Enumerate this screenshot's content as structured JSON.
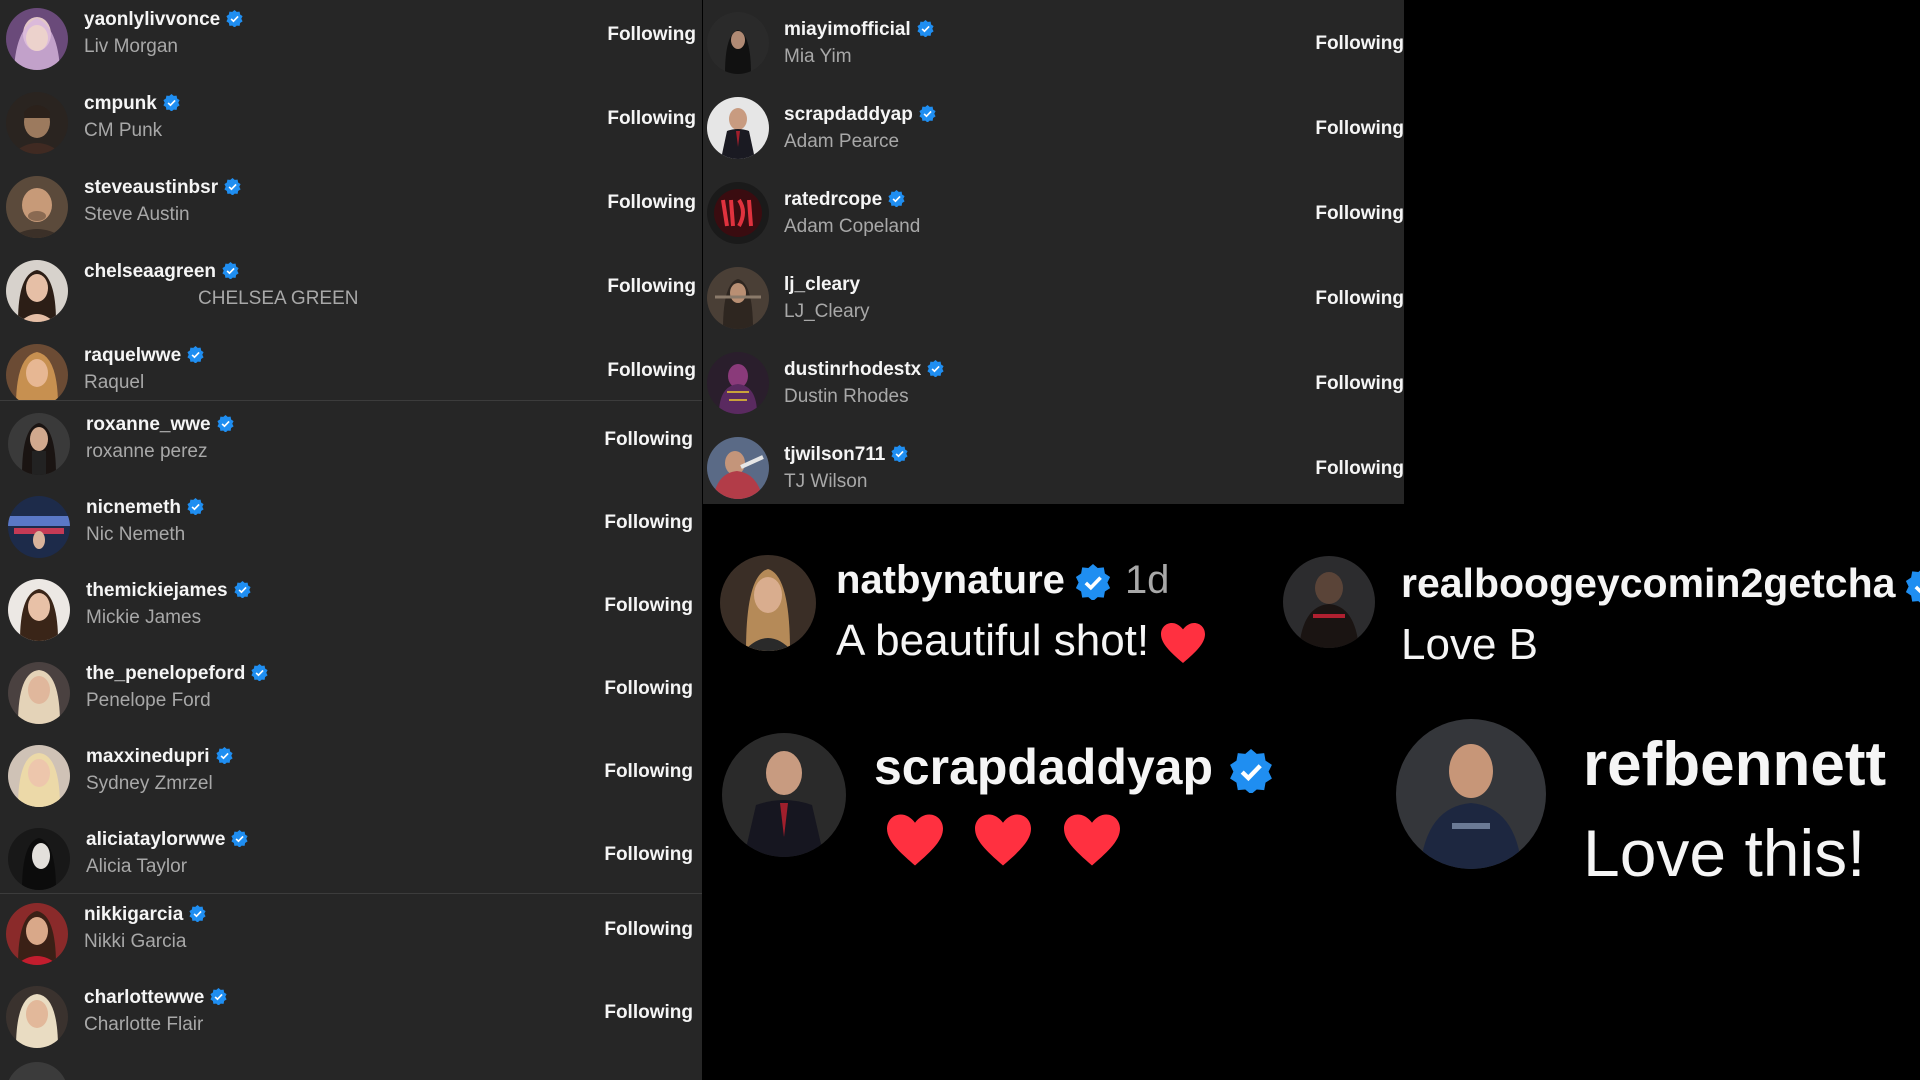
{
  "follow_label": "Following",
  "colors": {
    "verified": "#1f8ef1",
    "heart": "#ff3040",
    "panel": "#262626",
    "page": "#000000"
  },
  "left_list": [
    {
      "username": "yaonlylivvonce",
      "name": "Liv Morgan",
      "verified": true
    },
    {
      "username": "cmpunk",
      "name": "CM Punk",
      "verified": true
    },
    {
      "username": "steveaustinbsr",
      "name": "Steve Austin",
      "verified": true
    },
    {
      "username": "chelseaagreen",
      "name": "CHELSEA GREEN",
      "verified": true
    },
    {
      "username": "raquelwwe",
      "name": "Raquel",
      "verified": true
    },
    {
      "username": "roxanne_wwe",
      "name": "roxanne perez",
      "verified": true
    },
    {
      "username": "nicnemeth",
      "name": "Nic Nemeth",
      "verified": true
    },
    {
      "username": "themickiejames",
      "name": "Mickie James",
      "verified": true
    },
    {
      "username": "the_penelopeford",
      "name": "Penelope Ford",
      "verified": true
    },
    {
      "username": "maxxinedupri",
      "name": "Sydney Zmrzel",
      "verified": true
    },
    {
      "username": "aliciataylorwwe",
      "name": "Alicia Taylor",
      "verified": true
    },
    {
      "username": "nikkigarcia",
      "name": "Nikki Garcia",
      "verified": true
    },
    {
      "username": "charlottewwe",
      "name": "Charlotte Flair",
      "verified": true
    }
  ],
  "middle_list": [
    {
      "username": "miayimofficial",
      "name": "Mia Yim",
      "verified": true
    },
    {
      "username": "scrapdaddyap",
      "name": "Adam Pearce",
      "verified": true
    },
    {
      "username": "ratedrcope",
      "name": "Adam Copeland",
      "verified": true
    },
    {
      "username": "lj_cleary",
      "name": "LJ_Cleary",
      "verified": false
    },
    {
      "username": "dustinrhodestx",
      "name": "Dustin Rhodes",
      "verified": true
    },
    {
      "username": "tjwilson711",
      "name": "TJ Wilson",
      "verified": true
    }
  ],
  "comments": [
    {
      "username": "natbynature",
      "time": "1d",
      "text": "A beautiful shot!",
      "hearts": 1,
      "verified": true
    },
    {
      "username": "realboogeycomin2getcha",
      "text": "Love B",
      "hearts": 0,
      "verified": true
    },
    {
      "username": "scrapdaddyap",
      "text": "",
      "hearts": 3,
      "verified": true
    },
    {
      "username": "refbennett",
      "text": "Love this!",
      "hearts": 0,
      "verified": false
    }
  ]
}
